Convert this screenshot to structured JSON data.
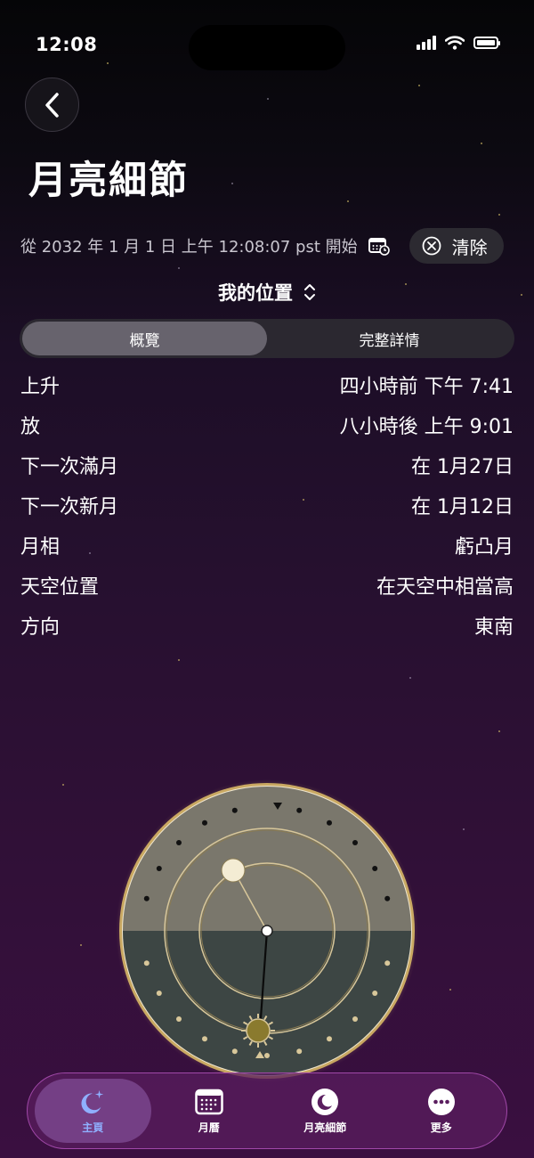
{
  "status_bar": {
    "time": "12:08"
  },
  "header": {
    "title": "月亮細節"
  },
  "date_row": {
    "text": "從 2032 年 1 月 1 日 上午 12:08:07 pst 開始",
    "clear_label": "清除"
  },
  "location": {
    "label": "我的位置"
  },
  "segments": [
    {
      "label": "概覽",
      "active": true
    },
    {
      "label": "完整詳情",
      "active": false
    }
  ],
  "details": [
    {
      "label": "上升",
      "value": "四小時前 下午 7:41"
    },
    {
      "label": "放",
      "value": "八小時後 上午 9:01"
    },
    {
      "label": "下一次滿月",
      "value": "在 1月27日"
    },
    {
      "label": "下一次新月",
      "value": "在 1月12日"
    },
    {
      "label": "月相",
      "value": "虧凸月"
    },
    {
      "label": "天空位置",
      "value": "在天空中相當高"
    },
    {
      "label": "方向",
      "value": "東南"
    }
  ],
  "tabs": [
    {
      "label": "主頁",
      "icon": "moon-stars-icon",
      "active": true
    },
    {
      "label": "月曆",
      "icon": "calendar-icon",
      "active": false
    },
    {
      "label": "月亮細節",
      "icon": "moon-icon",
      "active": false
    },
    {
      "label": "更多",
      "icon": "ellipsis-icon",
      "active": false
    }
  ],
  "colors": {
    "accent": "#8fb0ff",
    "dial_sky": "#7a776c",
    "dial_ground": "#3d4644",
    "dial_rim": "#b89a58"
  }
}
